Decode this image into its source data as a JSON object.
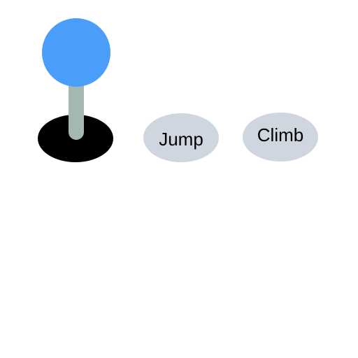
{
  "controls": {
    "joystick": {
      "knob_color": "#4a9df9",
      "shaft_color": "#a5b8b0",
      "base_color": "#000000"
    },
    "buttons": [
      {
        "label": "Jump",
        "color": "#cfd6e0"
      },
      {
        "label": "Climb",
        "color": "#cfd6e0"
      }
    ]
  }
}
